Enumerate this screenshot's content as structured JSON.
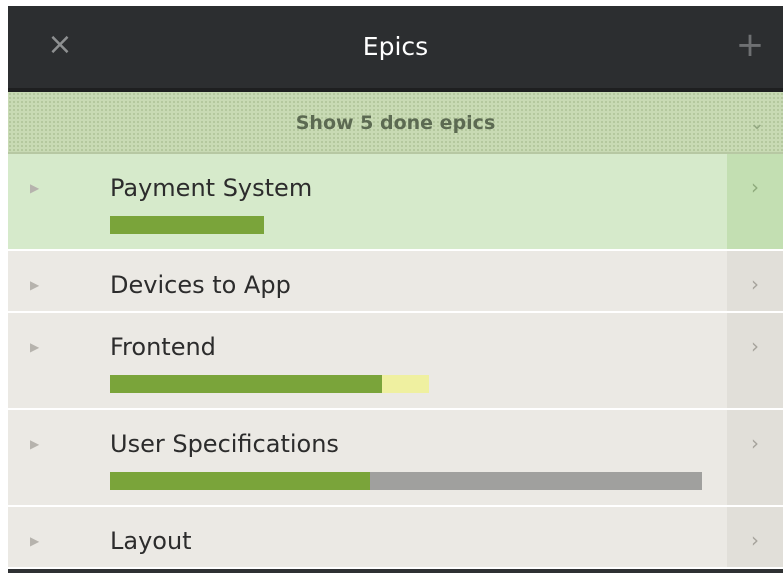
{
  "header": {
    "title": "Epics",
    "close_icon": "×",
    "add_icon": "+"
  },
  "done_toggle": {
    "label": "Show 5 done epics",
    "chevron_icon": "⌄"
  },
  "epics": [
    {
      "name": "Payment System",
      "active": true,
      "progress": {
        "done": 0.26,
        "in_progress": 0,
        "todo": 0
      }
    },
    {
      "name": "Devices to App",
      "active": false,
      "progress": null
    },
    {
      "name": "Frontend",
      "active": false,
      "progress": {
        "done": 0.46,
        "in_progress": 0.08,
        "todo": 0
      }
    },
    {
      "name": "User Specifications",
      "active": false,
      "progress": {
        "done": 0.44,
        "in_progress": 0,
        "todo": 0.56
      }
    },
    {
      "name": "Layout",
      "active": false,
      "progress": null
    }
  ],
  "icons": {
    "expand": "▶",
    "open": "›"
  },
  "colors": {
    "header_bg": "#2c2e30",
    "active_row": "#d6eacb",
    "row": "#ebe9e4",
    "done": "#7aa43a",
    "in_progress": "#eff0a0",
    "todo": "#a0a09e"
  }
}
